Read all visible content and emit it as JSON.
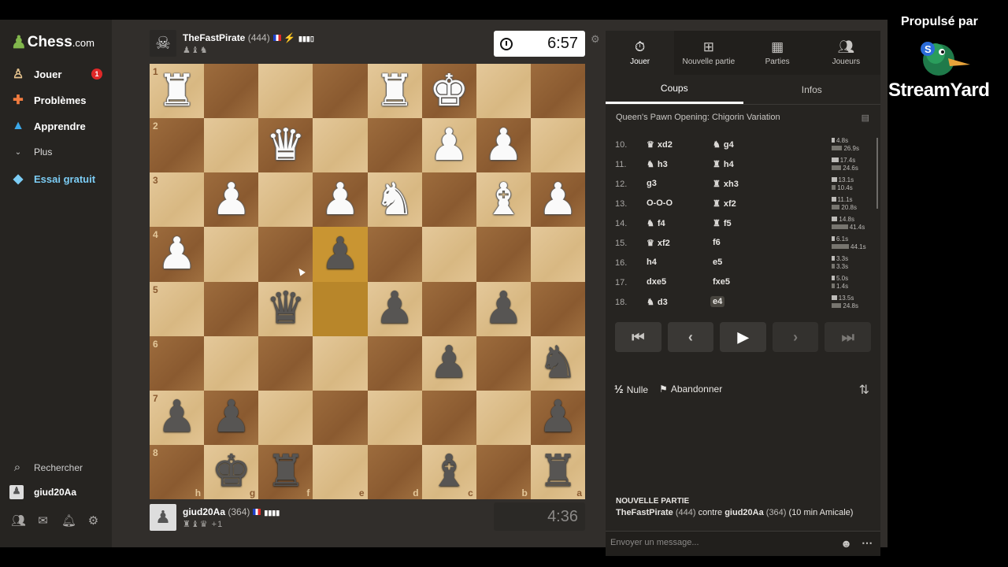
{
  "sidebar": {
    "logo_main": "Chess",
    "logo_suffix": ".com",
    "items": [
      {
        "label": "Jouer",
        "icon": "play-icon",
        "badge": "1"
      },
      {
        "label": "Problèmes",
        "icon": "puzzle-icon"
      },
      {
        "label": "Apprendre",
        "icon": "learn-icon"
      },
      {
        "label": "Plus",
        "icon": "chevron-down-icon"
      },
      {
        "label": "Essai gratuit",
        "icon": "diamond-icon"
      }
    ],
    "search_label": "Rechercher",
    "username": "giud20Aa"
  },
  "top_player": {
    "name": "TheFastPirate",
    "rating": "(444)",
    "clock": "6:57"
  },
  "bottom_player": {
    "name": "giud20Aa",
    "rating": "(364)",
    "material_diff": "+1",
    "clock": "4:36"
  },
  "board": {
    "ranks": [
      "1",
      "2",
      "3",
      "4",
      "5",
      "6",
      "7",
      "8"
    ],
    "files": [
      "h",
      "g",
      "f",
      "e",
      "d",
      "c",
      "b",
      "a"
    ],
    "rows": [
      [
        "wR",
        "",
        "",
        "",
        "wR",
        "wK",
        "",
        ""
      ],
      [
        "",
        "",
        "wQ",
        "",
        "",
        "wP",
        "wP",
        ""
      ],
      [
        "",
        "wP",
        "",
        "wP",
        "wN",
        "",
        "wB",
        "wP"
      ],
      [
        "wP",
        "",
        "",
        "bP",
        "",
        "",
        "",
        ""
      ],
      [
        "",
        "",
        "bQ",
        "",
        "bP",
        "",
        "bP",
        ""
      ],
      [
        "",
        "",
        "",
        "",
        "",
        "bP",
        "",
        "bN"
      ],
      [
        "bP",
        "bP",
        "",
        "",
        "",
        "",
        "",
        "bP"
      ],
      [
        "",
        "bK",
        "bR",
        "",
        "",
        "bB",
        "",
        "bR"
      ]
    ],
    "highlight": {
      "from": "e5",
      "to": "e4"
    },
    "colors": {
      "light": "#e4c89a",
      "dark": "#9d6c3d",
      "highlight": "#c99532"
    }
  },
  "panel": {
    "tabs": [
      {
        "label": "Jouer",
        "icon": "stopwatch-icon"
      },
      {
        "label": "Nouvelle partie",
        "icon": "plus-icon"
      },
      {
        "label": "Parties",
        "icon": "board-icon"
      },
      {
        "label": "Joueurs",
        "icon": "players-icon"
      }
    ],
    "subtabs": [
      "Coups",
      "Infos"
    ],
    "opening": "Queen's Pawn Opening: Chigorin Variation",
    "moves": [
      {
        "num": "10.",
        "w_piece": "♛",
        "w": "xd2",
        "b_piece": "♞",
        "b": "g4",
        "wt": "4.8s",
        "bt": "26.9s"
      },
      {
        "num": "11.",
        "w_piece": "♞",
        "w": "h3",
        "b_piece": "♜",
        "b": "h4",
        "wt": "17.4s",
        "bt": "24.6s"
      },
      {
        "num": "12.",
        "w_piece": "",
        "w": "g3",
        "b_piece": "♜",
        "b": "xh3",
        "wt": "13.1s",
        "bt": "10.4s"
      },
      {
        "num": "13.",
        "w_piece": "",
        "w": "O-O-O",
        "b_piece": "♜",
        "b": "xf2",
        "wt": "11.1s",
        "bt": "20.8s"
      },
      {
        "num": "14.",
        "w_piece": "♞",
        "w": "f4",
        "b_piece": "♜",
        "b": "f5",
        "wt": "14.8s",
        "bt": "41.4s"
      },
      {
        "num": "15.",
        "w_piece": "♛",
        "w": "xf2",
        "b_piece": "",
        "b": "f6",
        "wt": "6.1s",
        "bt": "44.1s"
      },
      {
        "num": "16.",
        "w_piece": "",
        "w": "h4",
        "b_piece": "",
        "b": "e5",
        "wt": "3.3s",
        "bt": "3.3s"
      },
      {
        "num": "17.",
        "w_piece": "",
        "w": "dxe5",
        "b_piece": "",
        "b": "fxe5",
        "wt": "5.0s",
        "bt": "1.4s"
      },
      {
        "num": "18.",
        "w_piece": "♞",
        "w": "d3",
        "b_piece": "",
        "b": "e4",
        "wt": "13.5s",
        "bt": "24.8s"
      }
    ],
    "draw_label": "Nulle",
    "draw_symbol": "½",
    "resign_label": "Abandonner",
    "new_game_title": "NOUVELLE PARTIE",
    "new_game_white": "TheFastPirate",
    "new_game_white_rating": "(444)",
    "new_game_vs": "contre",
    "new_game_black": "giud20Aa",
    "new_game_black_rating": "(364)",
    "new_game_mode": "(10 min Amicale)",
    "message_placeholder": "Envoyer un message..."
  },
  "overlay": {
    "powered_by": "Propulsé par",
    "brand": "StreamYard"
  }
}
